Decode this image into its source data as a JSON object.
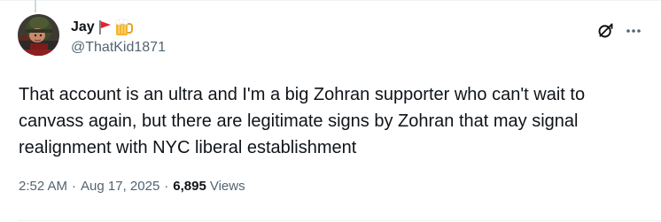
{
  "tweet": {
    "author": {
      "display_name": "Jay",
      "handle": "@ThatKid1871",
      "emoji": [
        "triangular-flag-icon",
        "beer-mug-icon"
      ]
    },
    "text": "That account is an ultra and I'm a big Zohran supporter who can't wait to canvass again, but there are legitimate signs by Zohran that may signal realignment with NYC liberal establishment",
    "time": "2:52 AM",
    "separator": "·",
    "date": "Aug 17, 2025",
    "views_count": "6,895",
    "views_label": "Views",
    "actions": [
      "grok-icon",
      "more-options-icon"
    ]
  },
  "colors": {
    "text_primary": "#0f1419",
    "text_secondary": "#536471",
    "divider": "#eff3f4",
    "thread_line": "#cfd9de",
    "flag_red": "#e8202e",
    "beer_amber": "#f5b52e"
  }
}
